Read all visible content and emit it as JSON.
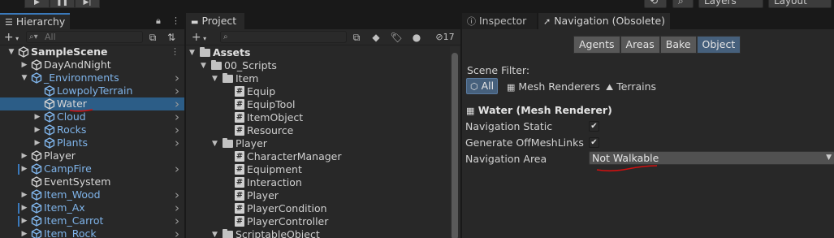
{
  "toolbar": {
    "play_icons": [
      "▶",
      "❚❚",
      "▶|"
    ],
    "layers_label": "Layers",
    "layout_label": "Layout"
  },
  "hierarchy": {
    "tab_label": "Hierarchy",
    "add_label": "+",
    "search_placeholder": "All",
    "rows": [
      {
        "label": "SampleScene",
        "depth": 0,
        "style": "bold",
        "expanded": true
      },
      {
        "label": "DayAndNight",
        "depth": 1,
        "style": "white",
        "expanded": false
      },
      {
        "label": "_Environments",
        "depth": 1,
        "style": "blue",
        "expanded": true
      },
      {
        "label": "LowpolyTerrain",
        "depth": 2,
        "style": "blue"
      },
      {
        "label": "Water",
        "depth": 2,
        "style": "white",
        "selected": true
      },
      {
        "label": "Cloud",
        "depth": 2,
        "style": "blue",
        "expanded": false
      },
      {
        "label": "Rocks",
        "depth": 2,
        "style": "blue",
        "expanded": false
      },
      {
        "label": "Plants",
        "depth": 2,
        "style": "blue",
        "expanded": false
      },
      {
        "label": "Player",
        "depth": 1,
        "style": "white",
        "expanded": false
      },
      {
        "label": "CampFire",
        "depth": 1,
        "style": "blue",
        "expanded": false,
        "marked": true
      },
      {
        "label": "EventSystem",
        "depth": 1,
        "style": "white"
      },
      {
        "label": "Item_Wood",
        "depth": 1,
        "style": "blue",
        "expanded": false
      },
      {
        "label": "Item_Ax",
        "depth": 1,
        "style": "blue",
        "expanded": false,
        "marked": true
      },
      {
        "label": "Item_Carrot",
        "depth": 1,
        "style": "blue",
        "expanded": false,
        "marked": true
      },
      {
        "label": "Item_Rock",
        "depth": 1,
        "style": "blue",
        "expanded": false
      }
    ]
  },
  "project": {
    "tab_label": "Project",
    "add_label": "+",
    "hidden_count": "17",
    "rows": [
      {
        "label": "Assets",
        "type": "folder",
        "depth": 0,
        "bold": true
      },
      {
        "label": "00_Scripts",
        "type": "folder",
        "depth": 1
      },
      {
        "label": "Item",
        "type": "folder",
        "depth": 2
      },
      {
        "label": "Equip",
        "type": "script",
        "depth": 3
      },
      {
        "label": "EquipTool",
        "type": "script",
        "depth": 3
      },
      {
        "label": "ItemObject",
        "type": "script",
        "depth": 3
      },
      {
        "label": "Resource",
        "type": "script",
        "depth": 3
      },
      {
        "label": "Player",
        "type": "folder",
        "depth": 2
      },
      {
        "label": "CharacterManager",
        "type": "script",
        "depth": 3
      },
      {
        "label": "Equipment",
        "type": "script",
        "depth": 3
      },
      {
        "label": "Interaction",
        "type": "script",
        "depth": 3
      },
      {
        "label": "Player",
        "type": "script",
        "depth": 3
      },
      {
        "label": "PlayerCondition",
        "type": "script",
        "depth": 3
      },
      {
        "label": "PlayerController",
        "type": "script",
        "depth": 3
      },
      {
        "label": "ScriptableObject",
        "type": "folder",
        "depth": 2
      }
    ]
  },
  "inspector": {
    "inspector_tab": "Inspector",
    "navigation_tab": "Navigation (Obsolete)",
    "segments": [
      "Agents",
      "Areas",
      "Bake",
      "Object"
    ],
    "active_segment": "Object",
    "scene_filter_label": "Scene Filter:",
    "filter_all": "All",
    "filter_mesh": "Mesh Renderers",
    "filter_terrains": "Terrains",
    "object_title": "Water (Mesh Renderer)",
    "nav_static_label": "Navigation Static",
    "nav_static_checked": true,
    "offmesh_label": "Generate OffMeshLinks",
    "offmesh_checked": true,
    "nav_area_label": "Navigation Area",
    "nav_area_value": "Not Walkable"
  },
  "colors": {
    "selection": "#2c5d87",
    "prefab_blue": "#7fb4ea",
    "active_segment": "#46607c",
    "annotation_red": "#d01010"
  }
}
